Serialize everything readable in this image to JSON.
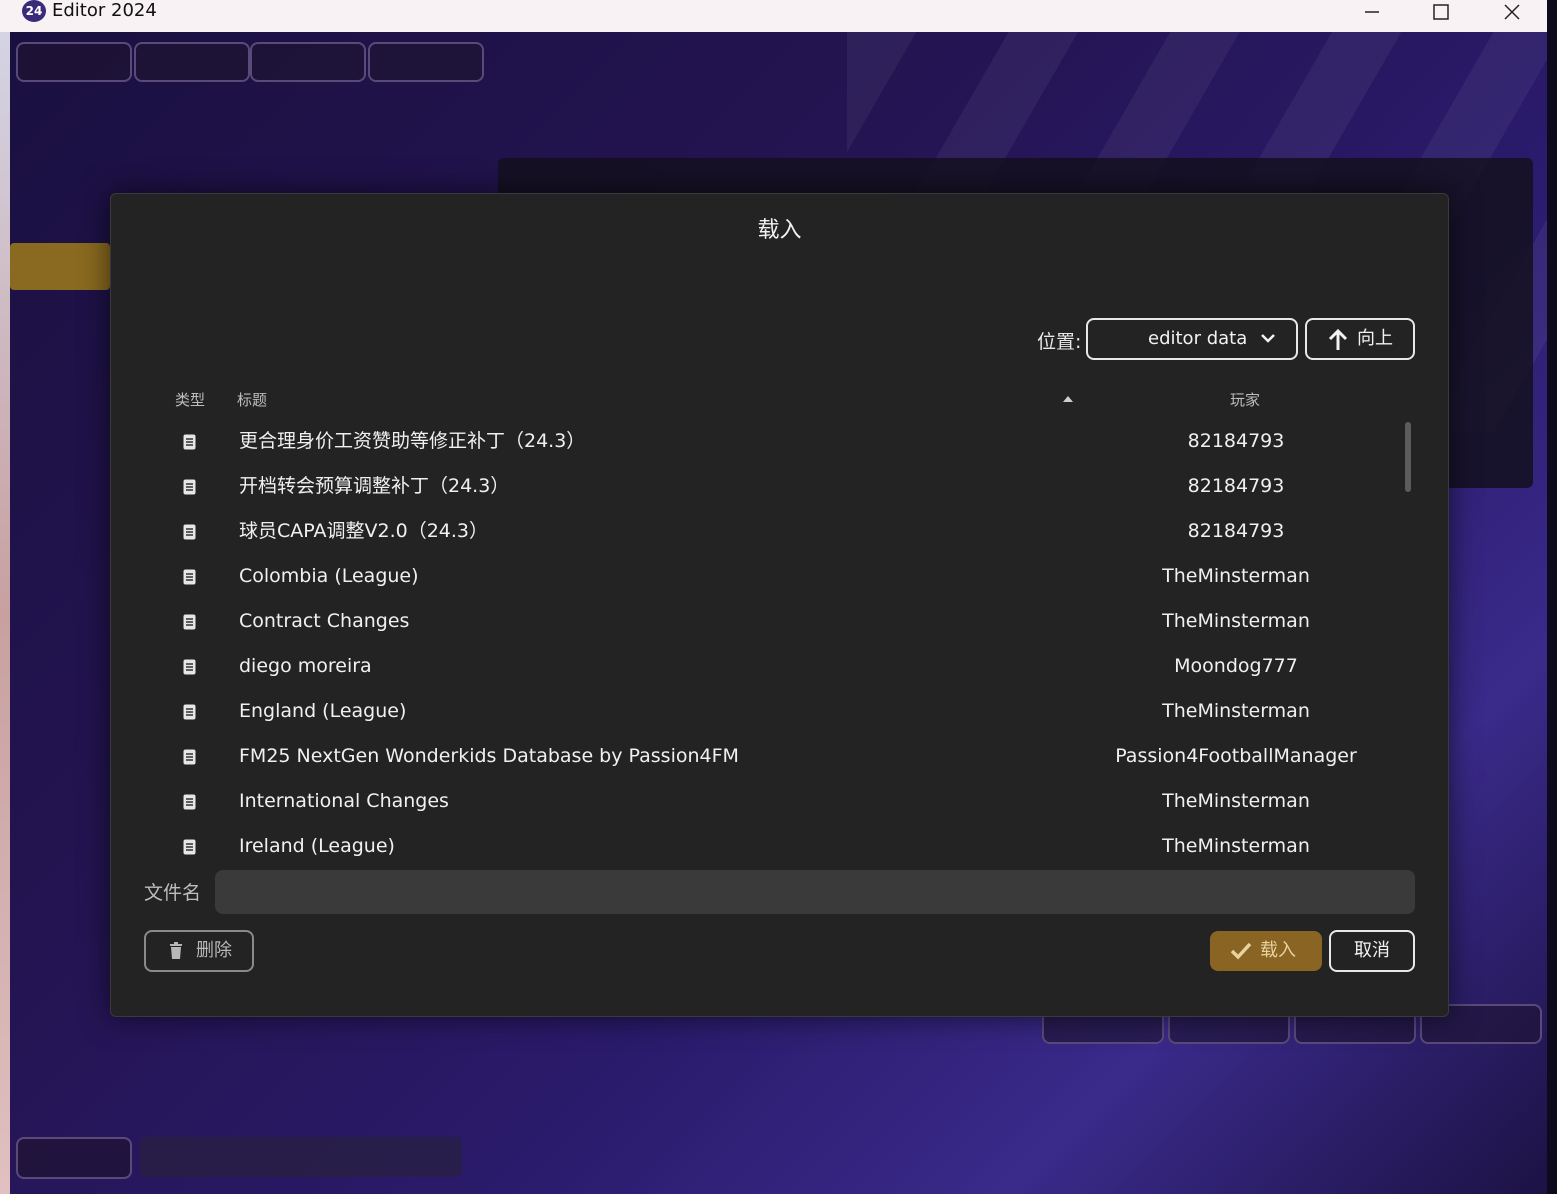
{
  "window": {
    "title": "Editor 2024",
    "icon_text": "24"
  },
  "dialog": {
    "title": "载入",
    "location_label": "位置:",
    "location_value": "editor data",
    "up_label": "向上",
    "columns": {
      "type": "类型",
      "title": "标题",
      "player": "玩家"
    },
    "files": [
      {
        "name": "更合理身价工资赞助等修正补丁（24.3）",
        "player": "82184793"
      },
      {
        "name": "开档转会预算调整补丁（24.3）",
        "player": "82184793"
      },
      {
        "name": "球员CAPA调整V2.0（24.3）",
        "player": "82184793"
      },
      {
        "name": "Colombia (League)",
        "player": "TheMinsterman"
      },
      {
        "name": "Contract Changes",
        "player": "TheMinsterman"
      },
      {
        "name": "diego moreira",
        "player": "Moondog777"
      },
      {
        "name": "England (League)",
        "player": "TheMinsterman"
      },
      {
        "name": "FM25 NextGen Wonderkids Database by Passion4FM",
        "player": "Passion4FootballManager"
      },
      {
        "name": "International Changes",
        "player": "TheMinsterman"
      },
      {
        "name": "Ireland (League)",
        "player": "TheMinsterman"
      }
    ],
    "filename_label": "文件名",
    "filename_value": "",
    "delete_label": "删除",
    "load_label": "载入",
    "cancel_label": "取消"
  },
  "colors": {
    "accent": "#8a6422",
    "dialog_bg": "#232323",
    "input_bg": "#3a3a3a"
  },
  "icons": [
    "file-icon",
    "chevron-down-icon",
    "up-arrow-icon",
    "trash-icon",
    "check-icon",
    "sort-asc-icon",
    "minimize-icon",
    "maximize-icon",
    "close-icon"
  ]
}
